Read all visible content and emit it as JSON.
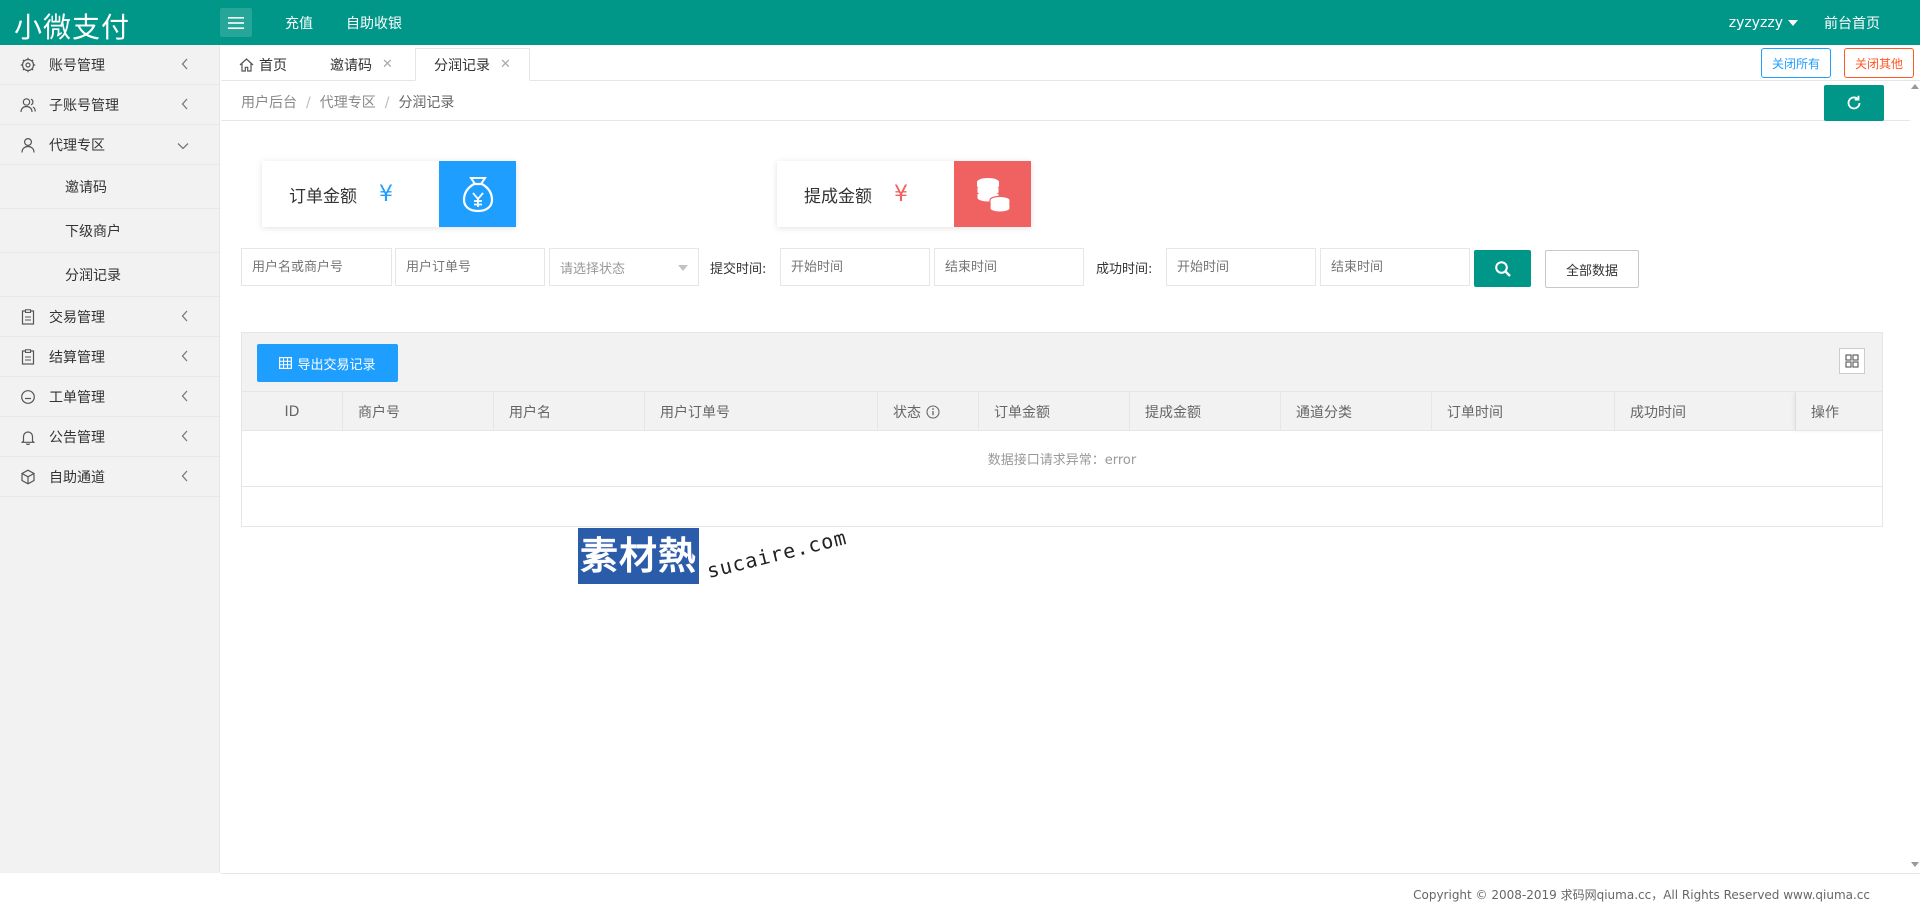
{
  "header": {
    "logo": "小微支付",
    "nav": [
      "充值",
      "自助收银"
    ],
    "user": "zyzyzzy",
    "front_link": "前台首页",
    "color": "#009688"
  },
  "sidebar": {
    "items": [
      {
        "label": "账号管理",
        "icon": "gear-icon"
      },
      {
        "label": "子账号管理",
        "icon": "user-group-icon"
      },
      {
        "label": "代理专区",
        "icon": "user-icon",
        "expanded": true,
        "children": [
          "邀请码",
          "下级商户",
          "分润记录"
        ]
      },
      {
        "label": "交易管理",
        "icon": "clipboard-icon"
      },
      {
        "label": "结算管理",
        "icon": "clipboard-icon"
      },
      {
        "label": "工单管理",
        "icon": "face-icon"
      },
      {
        "label": "公告管理",
        "icon": "bell-icon"
      },
      {
        "label": "自助通道",
        "icon": "cube-icon"
      }
    ]
  },
  "tabs": [
    {
      "label": "首页",
      "icon": "home-icon"
    },
    {
      "label": "邀请码",
      "closable": true
    },
    {
      "label": "分润记录",
      "closable": true,
      "active": true
    }
  ],
  "tab_actions": {
    "close_all": "关闭所有",
    "close_other": "关闭其他"
  },
  "breadcrumb": [
    "用户后台",
    "代理专区",
    "分润记录"
  ],
  "stats": [
    {
      "label": "订单金额",
      "currency": "¥",
      "color": "#1E9FFF",
      "icon": "money-bag-icon"
    },
    {
      "label": "提成金额",
      "currency": "¥",
      "color": "#F06161",
      "icon": "coins-icon"
    }
  ],
  "filters": {
    "username_placeholder": "用户名或商户号",
    "order_placeholder": "用户订单号",
    "status_placeholder": "请选择状态",
    "submit_time_label": "提交时间:",
    "start_placeholder": "开始时间",
    "end_placeholder": "结束时间",
    "success_time_label": "成功时间:",
    "all_data": "全部数据"
  },
  "table": {
    "export_label": "导出交易记录",
    "columns": [
      "ID",
      "商户号",
      "用户名",
      "用户订单号",
      "状态",
      "订单金额",
      "提成金额",
      "通道分类",
      "订单时间",
      "成功时间",
      "操作"
    ],
    "empty_message": "数据接口请求异常：error"
  },
  "watermark": {
    "cn": "素材熱",
    "en": "sucaire.com"
  },
  "footer": {
    "copyright": "Copyright © 2008-2019 求码网qiuma.cc，All Rights Reserved www.qiuma.cc"
  }
}
